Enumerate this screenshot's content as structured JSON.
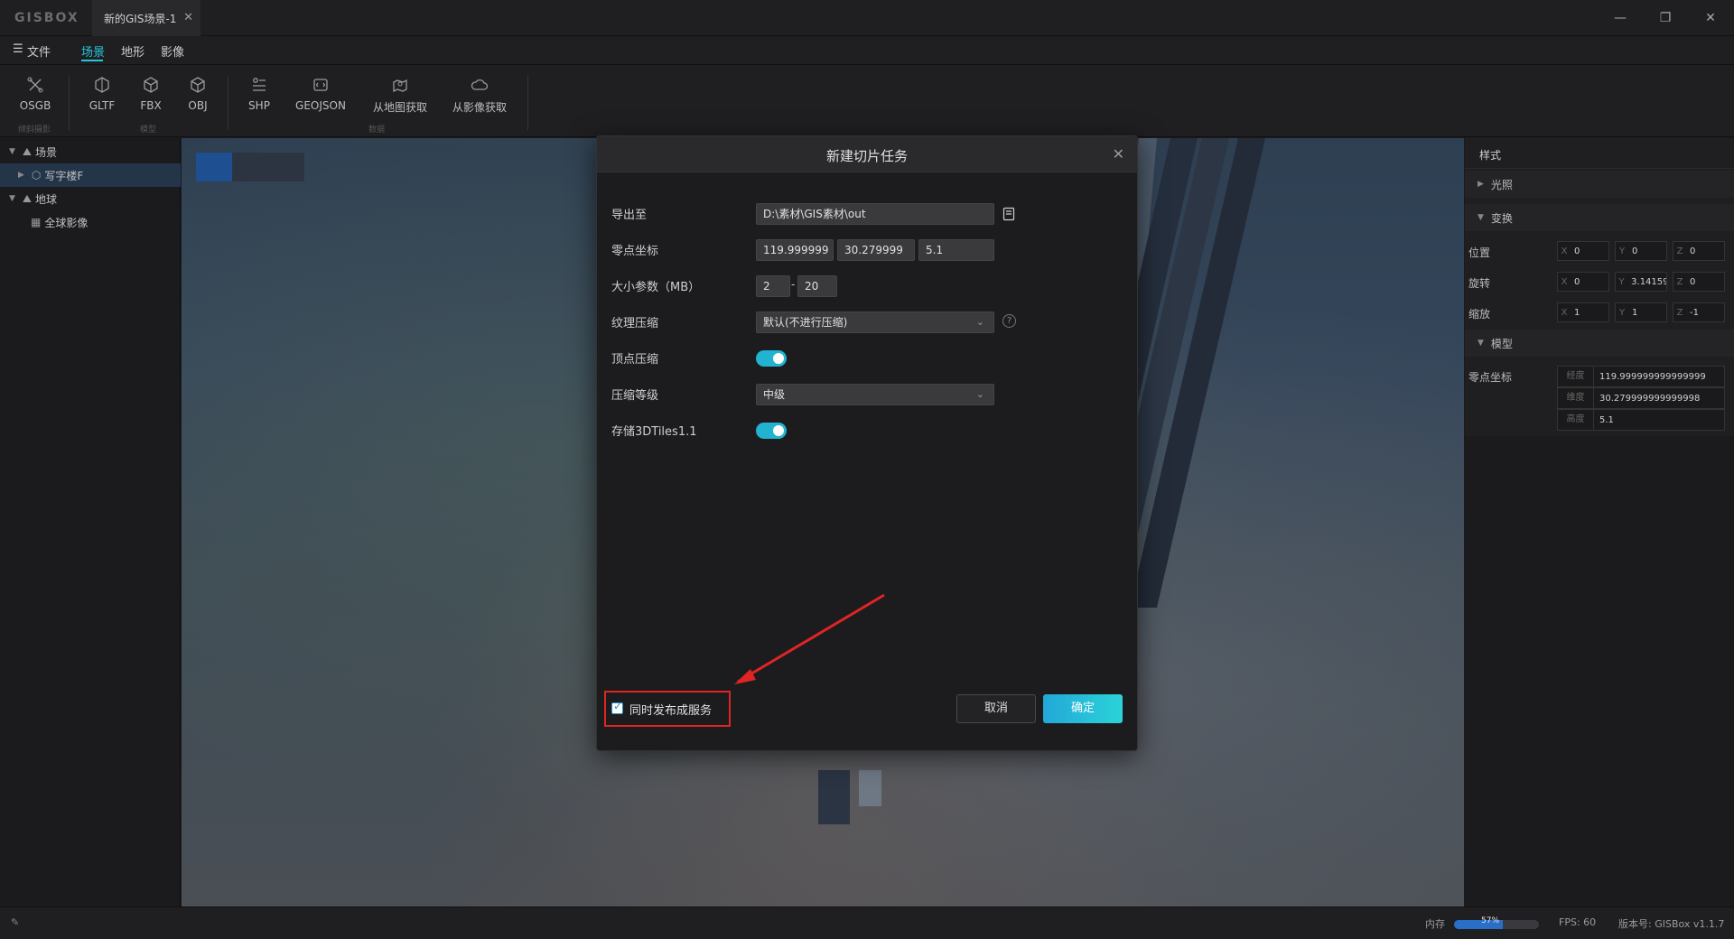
{
  "app": {
    "logo": "GISBOX",
    "doc_tab": "新的GIS场景-1",
    "close_glyph": "✕"
  },
  "window_controls": {
    "minimize": "—",
    "restore": "❐",
    "close": "✕"
  },
  "menu": {
    "file": "文件",
    "hamburger": "☰",
    "scene": "场景",
    "terrain": "地形",
    "imagery": "影像"
  },
  "ribbon": {
    "buttons": [
      "OSGB",
      "GLTF",
      "FBX",
      "OBJ",
      "SHP",
      "GEOJSON",
      "从地图获取",
      "从影像获取"
    ],
    "groups": {
      "oblique": "倾斜摄影",
      "model": "模型",
      "data": "数据"
    }
  },
  "tree": {
    "scene": "场景",
    "building": "写字楼F",
    "earth": "地球",
    "global_imagery": "全球影像"
  },
  "right_panel": {
    "tab": "样式",
    "sections": {
      "lighting": "光照",
      "transform": "变换",
      "model": "模型"
    },
    "transform": {
      "position_label": "位置",
      "rotation_label": "旋转",
      "scale_label": "缩放",
      "position": {
        "x": "0",
        "y": "0",
        "z": "0"
      },
      "rotation": {
        "x": "0",
        "y": "3.14159",
        "z": "0"
      },
      "scale": {
        "x": "1",
        "y": "1",
        "z": "-1"
      }
    },
    "model": {
      "origin_label": "零点坐标",
      "lon_label": "经度",
      "lon": "119.999999999999999",
      "lat_label": "维度",
      "lat": "30.279999999999998",
      "alt_label": "高度",
      "alt": "5.1"
    }
  },
  "status": {
    "memory_label": "内存",
    "memory_pct": "57%",
    "memory_fraction": 0.57,
    "fps": "FPS: 60",
    "version": "版本号: GISBox v1.1.7"
  },
  "modal": {
    "title": "新建切片任务",
    "close": "✕",
    "export_label": "导出至",
    "export_path": "D:\\素材\\GIS素材\\out",
    "origin_label": "零点坐标",
    "origin_x": "119.999999",
    "origin_y": "30.279999",
    "origin_z": "5.1",
    "size_label": "大小参数（MB）",
    "size_min": "2",
    "size_sep": "-",
    "size_max": "20",
    "texture_label": "纹理压缩",
    "texture_value": "默认(不进行压缩)",
    "vertex_label": "顶点压缩",
    "vertex_on": true,
    "level_label": "压缩等级",
    "level_value": "中级",
    "store_label": "存储3DTiles1.1",
    "store_on": true,
    "publish_label": "同时发布成服务",
    "publish_checked": true,
    "cancel": "取消",
    "ok": "确定"
  },
  "colors": {
    "accent": "#26c6da",
    "annotation": "#e02424",
    "selection": "#243449"
  }
}
